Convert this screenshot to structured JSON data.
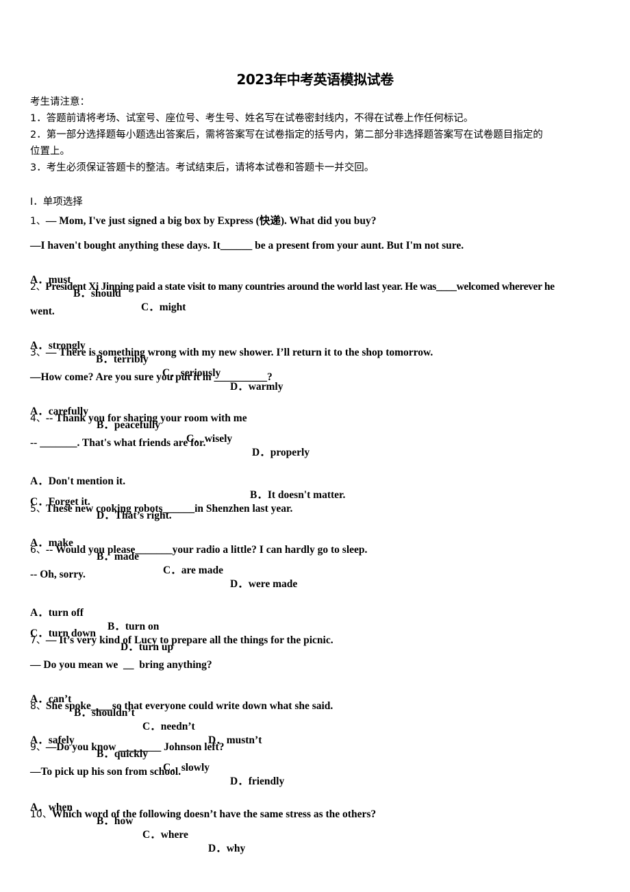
{
  "document": {
    "title": "2023年中考英语模拟试卷",
    "notice": {
      "heading": "考生请注意：",
      "items": [
        "1．答题前请将考场、试室号、座位号、考生号、姓名写在试卷密封线内，不得在试卷上作任何标记。",
        "2．第一部分选择题每小题选出答案后，需将答案写在试卷指定的括号内，第二部分非选择题答案写在试卷题目指定的",
        "位置上。",
        "3．考生必须保证答题卡的整洁。考试结束后，请将本试卷和答题卡一并交回。"
      ]
    },
    "section": "Ⅰ．单项选择",
    "questions": [
      {
        "number": "1、",
        "lines": [
          "— Mom, I've just signed a big box by Express (快递). What did you buy?",
          "—I haven't bought anything these days. It______ be a present from your aunt. But I'm not sure."
        ],
        "options": [
          "A．must",
          "B．should",
          "C．might"
        ]
      },
      {
        "number": "2、",
        "lines": [
          "President Xi Jinping paid a state visit to many countries around the world last year. He was____welcomed wherever he",
          "went."
        ],
        "options": [
          "A．strongly",
          "B．terribly",
          "C．seriously",
          "D．warmly"
        ]
      },
      {
        "number": "3、",
        "lines": [
          "— There is something wrong with my new shower. I’ll return it to the shop tomorrow.",
          "—How come? Are you sure you put it in __________?"
        ],
        "options": [
          "A．carefully",
          "B．peacefully",
          "C．wisely",
          "D．properly"
        ]
      },
      {
        "number": "4、",
        "lines": [
          "-- Thank you for sharing your room with me",
          "-- _______. That's what friends are for."
        ],
        "options": [
          "A．Don't mention it.",
          "B．It doesn't matter.",
          "C．Forget it.",
          "D．That’s right."
        ]
      },
      {
        "number": "5、",
        "lines": [
          "These new cooking robots______in Shenzhen last year."
        ],
        "options": [
          "A．make",
          "B．made",
          "C．are made",
          "D．were made"
        ]
      },
      {
        "number": "6、",
        "lines": [
          "-- Would you please_______your radio a little? I can hardly go to sleep.",
          "-- Oh, sorry."
        ],
        "options": [
          "A．turn off",
          "B．turn on",
          "C．turn down",
          "D．turn up"
        ]
      },
      {
        "number": "7、",
        "lines": [
          "— It’s very kind of Lucy to prepare all the things for the picnic.",
          "— Do you mean we  __  bring anything?"
        ],
        "options": [
          "A．can’t",
          "B．shouldn’t",
          "C．needn’t",
          "D．mustn’t"
        ]
      },
      {
        "number": "8、",
        "lines": [
          "She spoke____so that everyone could write down what she said."
        ],
        "options": [
          "A．safely",
          "B．quickly",
          "C．slowly",
          "D．friendly"
        ]
      },
      {
        "number": "9、",
        "lines": [
          "—Do you know ________ Johnson left?",
          "—To pick up his son from school."
        ],
        "options": [
          "A．when",
          "B．how",
          "C．where",
          "D．why"
        ]
      },
      {
        "number": "10、",
        "lines": [
          "Which word of the following doesn’t have the same stress as the others?"
        ],
        "options": []
      }
    ]
  }
}
